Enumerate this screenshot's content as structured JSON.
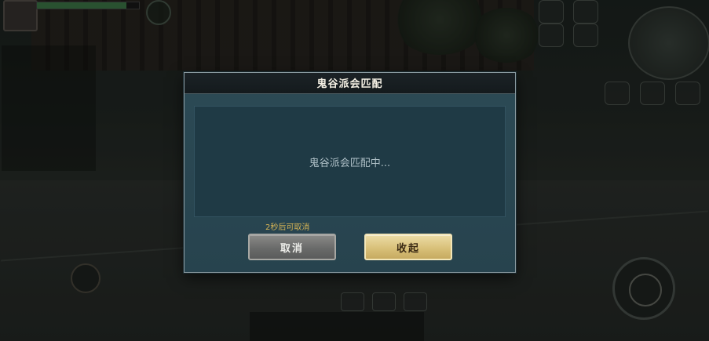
{
  "dialog": {
    "title": "鬼谷派会匹配",
    "message": "鬼谷派会匹配中...",
    "countdown_note": "2秒后可取消",
    "cancel_label": "取消",
    "collapse_label": "收起"
  },
  "colors": {
    "dialog_bg": "#2c4a55",
    "header_bg": "#141a1d",
    "countdown_text": "#d6b455",
    "cancel_button": "#6a6b6a",
    "collapse_button": "#d9c17a"
  }
}
